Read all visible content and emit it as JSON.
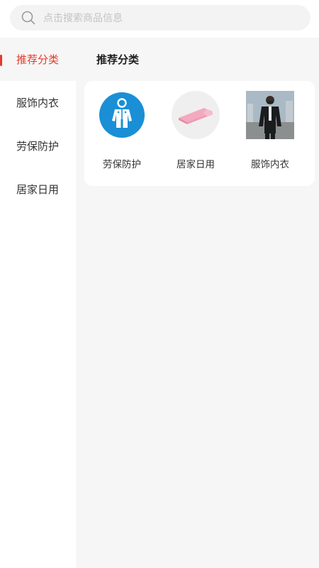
{
  "search": {
    "placeholder": "点击搜索商品信息",
    "icon": "search-icon"
  },
  "sidebar": {
    "items": [
      {
        "label": "推荐分类",
        "active": true
      },
      {
        "label": "服饰内衣",
        "active": false
      },
      {
        "label": "劳保防护",
        "active": false
      },
      {
        "label": "居家日用",
        "active": false
      }
    ]
  },
  "main": {
    "section_title": "推荐分类",
    "categories": [
      {
        "label": "劳保防护",
        "icon": "protective-suit-icon"
      },
      {
        "label": "居家日用",
        "icon": "yoga-mat-icon"
      },
      {
        "label": "服饰内衣",
        "icon": "jacket-photo"
      }
    ]
  },
  "colors": {
    "accent": "#e53a2b",
    "background": "#f6f6f6",
    "protective_blue": "#1a8fd6",
    "mat_pink": "#f3a9c0"
  }
}
